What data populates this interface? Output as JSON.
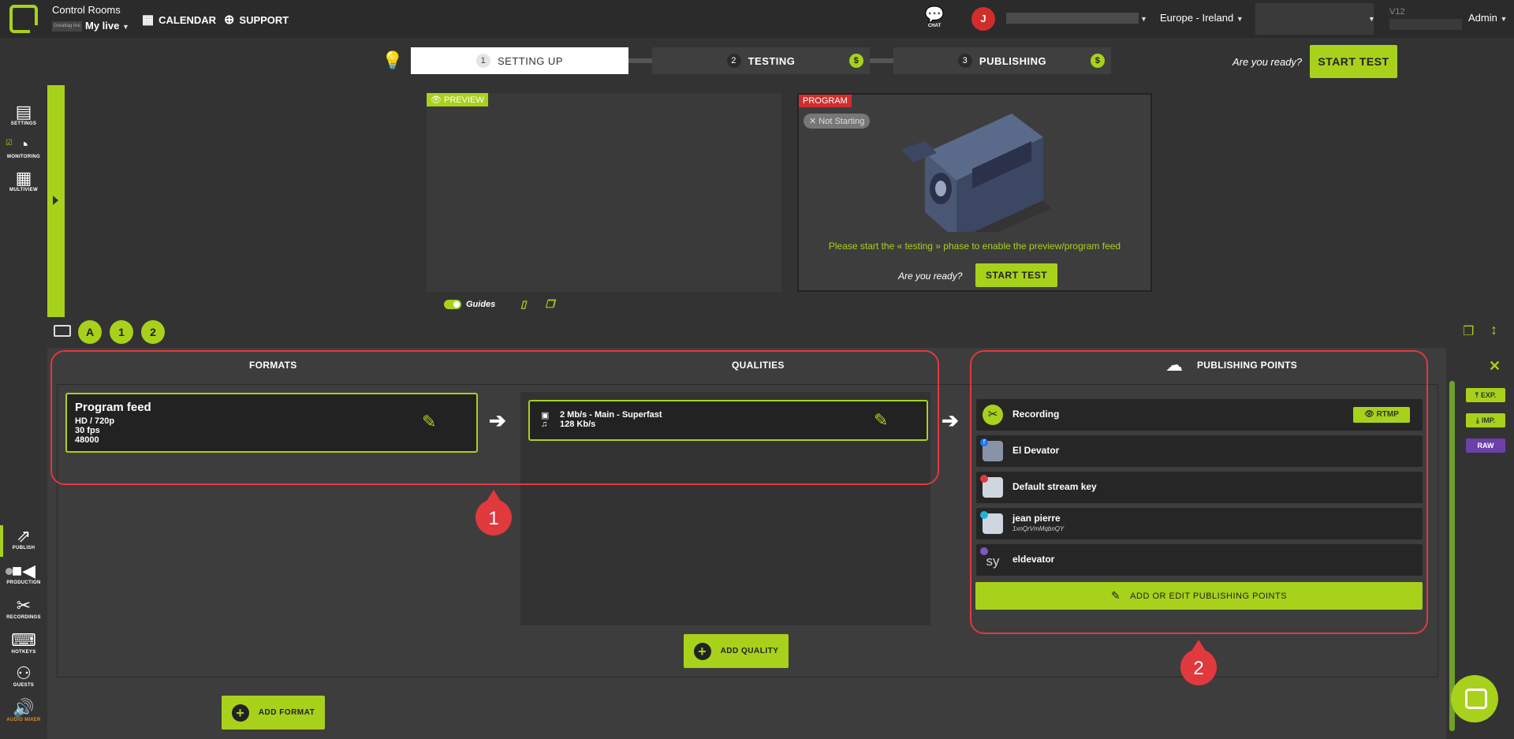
{
  "header": {
    "app_title": "Control Rooms",
    "brand_chip": "Greattag live",
    "live_name": "My live",
    "nav": [
      {
        "label": "CALENDAR",
        "icon": "calendar-icon"
      },
      {
        "label": "SUPPORT",
        "icon": "lifebuoy-icon"
      }
    ],
    "chat_label": "CHAT",
    "avatar_initial": "J",
    "region": "Europe - Ireland",
    "version": "V12",
    "role": "Admin"
  },
  "steps": [
    {
      "num": "1",
      "label": "SETTING UP",
      "active": true
    },
    {
      "num": "2",
      "label": "TESTING",
      "paid": "$"
    },
    {
      "num": "3",
      "label": "PUBLISHING",
      "paid": "$"
    }
  ],
  "ready_question": "Are you ready?",
  "start_test_label": "START TEST",
  "left_rail_top": [
    {
      "label": "SETTINGS",
      "icon": "settings-icon"
    },
    {
      "label": "MONITORING",
      "icon": "gauge-icon"
    },
    {
      "label": "MULTIVIEW",
      "icon": "grid-icon"
    }
  ],
  "left_rail_bottom": [
    {
      "label": "PUBLISH",
      "icon": "publish-icon"
    },
    {
      "label": "PRODUCTION",
      "icon": "camera-icon"
    },
    {
      "label": "RECORDINGS",
      "icon": "scissors-icon"
    },
    {
      "label": "HOTKEYS",
      "icon": "keyboard-icon"
    },
    {
      "label": "GUESTS",
      "icon": "guests-icon"
    },
    {
      "label": "AUDIO MIXER",
      "icon": "speaker-icon"
    }
  ],
  "preview": {
    "tag": "PREVIEW"
  },
  "program": {
    "tag": "PROGRAM",
    "status": "Not Starting",
    "message": "Please start the « testing » phase to enable the preview/program feed",
    "ready_question": "Are you ready?",
    "start_label": "START TEST"
  },
  "tools": {
    "guides_label": "Guides"
  },
  "hotkey_buttons": [
    "A",
    "1",
    "2"
  ],
  "columns": {
    "formats": "FORMATS",
    "qualities": "QUALITIES",
    "publishing": "PUBLISHING POINTS"
  },
  "format_card": {
    "title": "Program feed",
    "lines": [
      "HD / 720p",
      "30 fps",
      "48000"
    ]
  },
  "quality_card": {
    "video": "2 Mb/s  -  Main  -  Superfast",
    "audio": "128 Kb/s"
  },
  "publishing_points": [
    {
      "name": "Recording",
      "sub": "",
      "badge": "RTMP"
    },
    {
      "name": "El Devator",
      "sub": ""
    },
    {
      "name": "Default stream key",
      "sub": ""
    },
    {
      "name": "jean pierre",
      "sub": "1xnQrVmMqbnQY"
    },
    {
      "name": "eldevator",
      "sub": ""
    }
  ],
  "add_edit_label": "ADD OR EDIT PUBLISHING POINTS",
  "add_quality_label": "ADD QUALITY",
  "add_format_label": "ADD FORMAT",
  "annotations": [
    "1",
    "2"
  ],
  "right_rail": {
    "export": "EXP.",
    "import": "IMP.",
    "raw": "RAW"
  }
}
